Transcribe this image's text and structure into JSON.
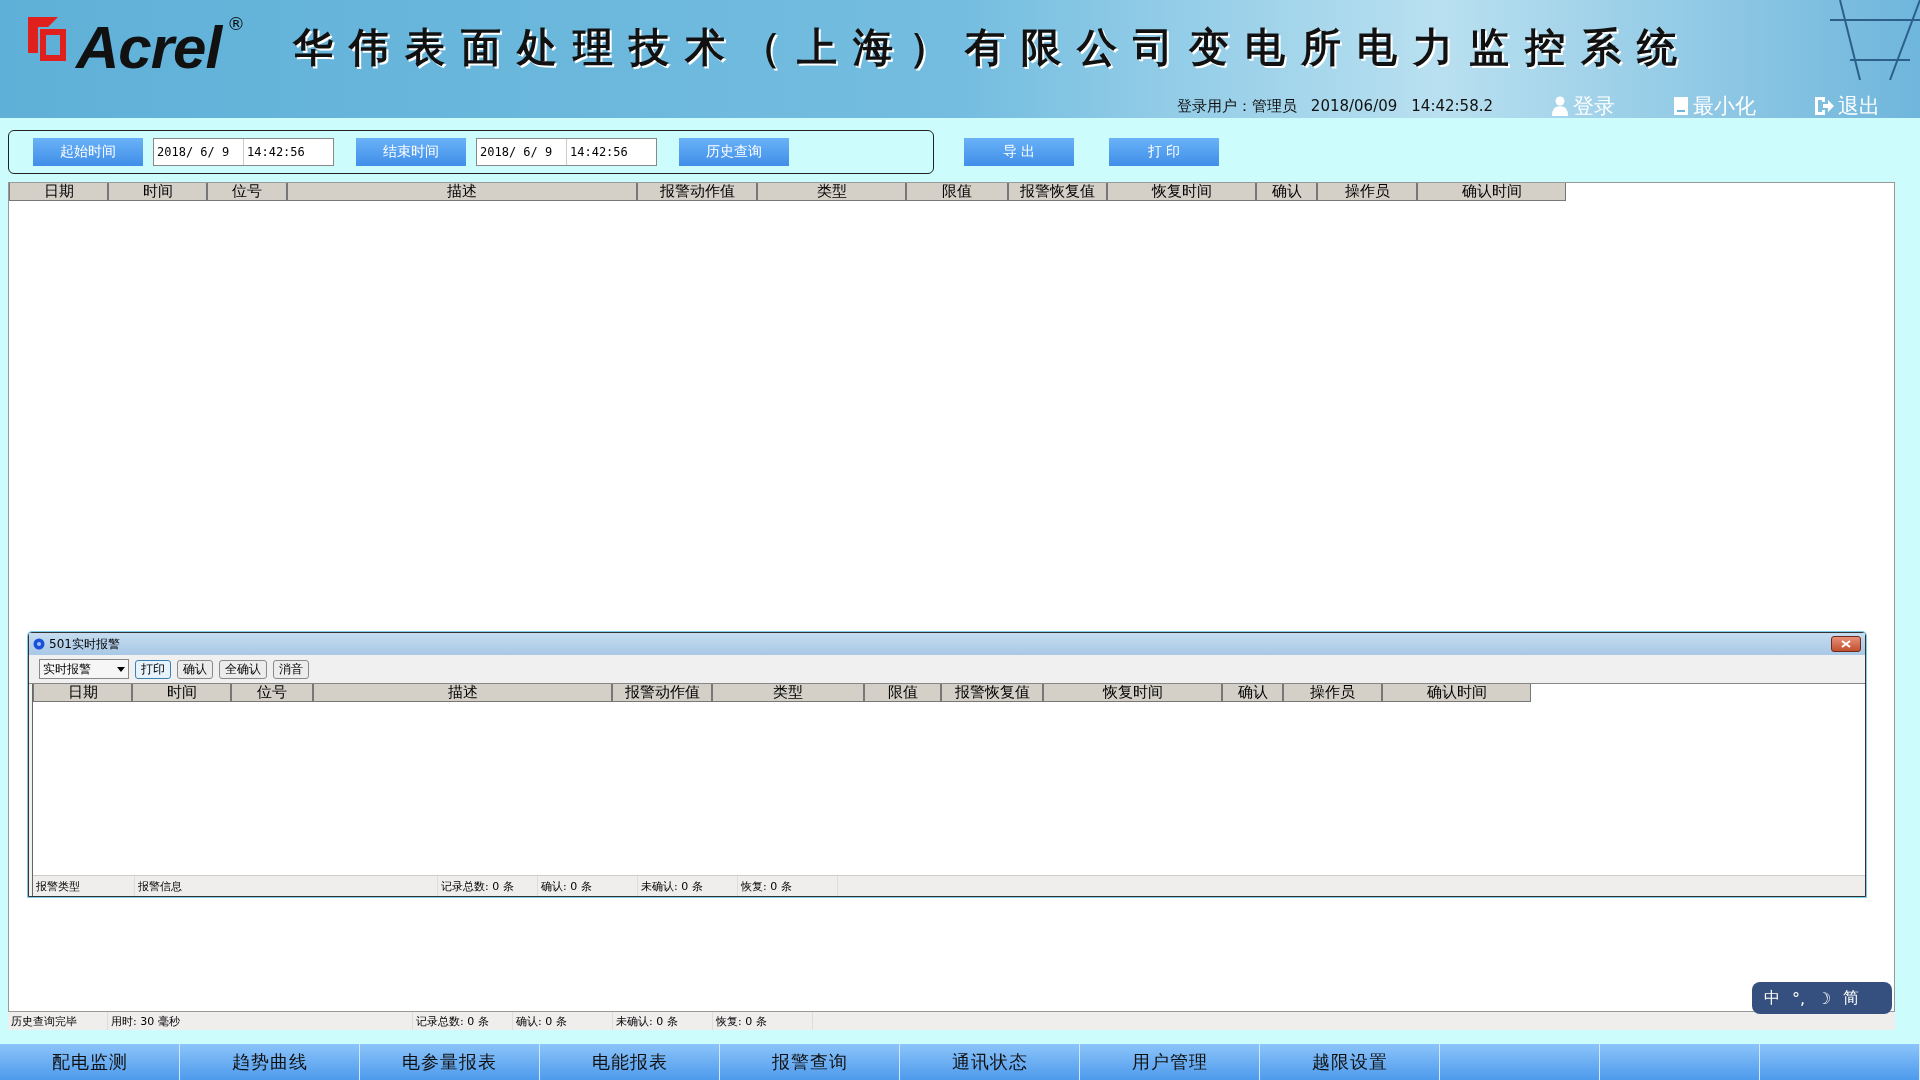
{
  "header": {
    "logo": "Acrel",
    "logo_mark": "®",
    "title": "华伟表面处理技术（上海）有限公司变电所电力监控系统",
    "user_label": "登录用户：",
    "user": "管理员",
    "date": "2018/06/09",
    "time": "14:42:58.2",
    "actions": [
      {
        "kind": "user",
        "label": "登录"
      },
      {
        "kind": "minimize",
        "label": "最小化"
      },
      {
        "kind": "exit",
        "label": "退出"
      }
    ]
  },
  "query": {
    "start_button": "起始时间",
    "start_date": "2018/ 6/ 9",
    "start_time": "14:42:56",
    "end_button": "结束时间",
    "end_date": "2018/ 6/ 9",
    "end_time": "14:42:56",
    "search_button": "历史查询",
    "export_button": "导 出",
    "print_button": "打 印"
  },
  "table": {
    "columns": [
      "日期",
      "时间",
      "位号",
      "描述",
      "报警动作值",
      "类型",
      "限值",
      "报警恢复值",
      "恢复时间",
      "确认",
      "操作员",
      "确认时间"
    ]
  },
  "alarm_window": {
    "title": "501实时报警",
    "dropdown": "实时报警",
    "buttons": [
      {
        "label": "打印",
        "selected": true
      },
      {
        "label": "确认",
        "selected": false
      },
      {
        "label": "全确认",
        "selected": false
      },
      {
        "label": "消音",
        "selected": false
      }
    ],
    "columns": [
      "日期",
      "时间",
      "位号",
      "描述",
      "报警动作值",
      "类型",
      "限值",
      "报警恢复值",
      "恢复时间",
      "确认",
      "操作员",
      "确认时间"
    ],
    "status": [
      "报警类型",
      "报警信息",
      "记录总数: 0 条",
      "确认: 0 条",
      "未确认: 0 条",
      "恢复: 0 条"
    ]
  },
  "status_bar": [
    "历史查询完毕",
    "用时: 30 毫秒",
    "记录总数: 0 条",
    "确认: 0 条",
    "未确认: 0 条",
    "恢复: 0 条"
  ],
  "ime": [
    "中",
    "°,",
    "☽",
    "简"
  ],
  "nav": [
    {
      "label": "配电监测"
    },
    {
      "label": "趋势曲线"
    },
    {
      "label": "电参量报表"
    },
    {
      "label": "电能报表"
    },
    {
      "label": "报警查询"
    },
    {
      "label": "通讯状态"
    },
    {
      "label": "用户管理"
    },
    {
      "label": "越限设置"
    }
  ]
}
